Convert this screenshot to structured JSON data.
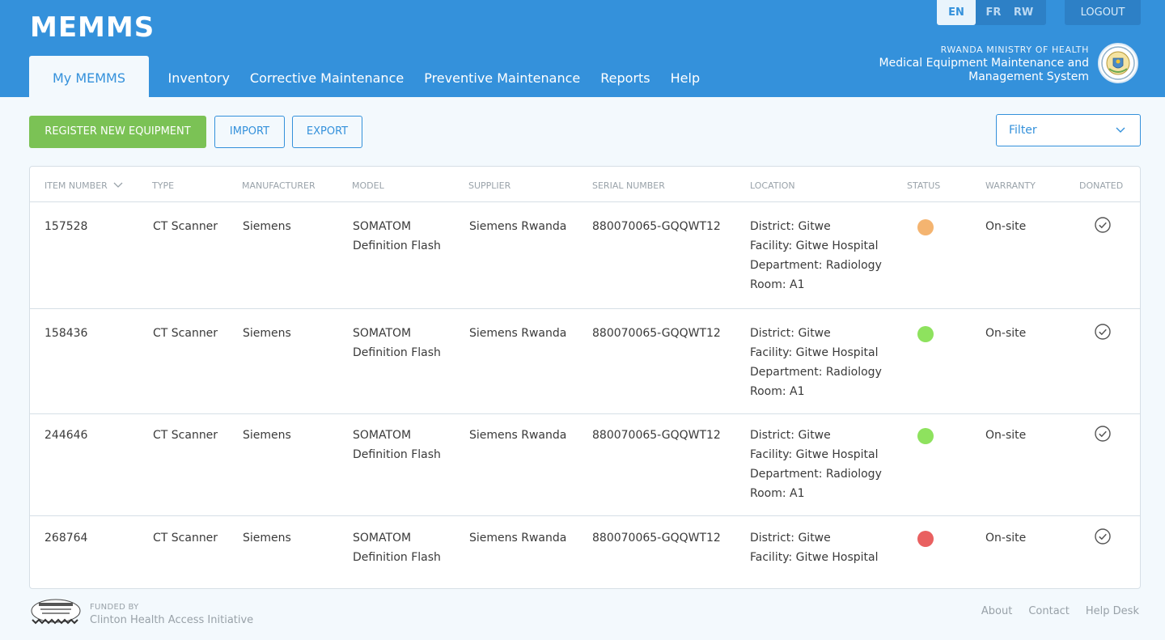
{
  "app": {
    "title": "MEMMS"
  },
  "nav": {
    "items": [
      "My MEMMS",
      "Inventory",
      "Corrective Maintenance",
      "Preventive Maintenance",
      "Reports",
      "Help"
    ]
  },
  "language": {
    "options": [
      "EN",
      "FR",
      "RW"
    ],
    "selected": "EN"
  },
  "logout_label": "LOGOUT",
  "ministry": {
    "line1": "RWANDA MINISTRY OF HEALTH",
    "line2": "Medical Equipment Maintenance and",
    "line3": "Management System"
  },
  "toolbar": {
    "register_label": "REGISTER NEW EQUIPMENT",
    "import_label": "IMPORT",
    "export_label": "EXPORT",
    "filter_placeholder": "Filter"
  },
  "colors": {
    "header": "#3491db",
    "green": "#7bc255",
    "status_pending": "#f4b470",
    "status_ok": "#8ee25e",
    "status_down": "#e96060"
  },
  "table": {
    "columns": [
      "ITEM NUMBER",
      "TYPE",
      "MANUFACTURER",
      "MODEL",
      "SUPPLIER",
      "SERIAL NUMBER",
      "LOCATION",
      "STATUS",
      "WARRANTY",
      "DONATED"
    ],
    "sort_column": "ITEM NUMBER",
    "rows": [
      {
        "item": "157528",
        "type": "CT Scanner",
        "manufacturer": "Siemens",
        "model1": "SOMATOM",
        "model2": "Definition Flash",
        "supplier": "Siemens Rwanda",
        "serial": "880070065-GQQWT12",
        "loc": [
          "District: Gitwe",
          "Facility: Gitwe Hospital",
          "Department: Radiology",
          "Room: A1"
        ],
        "status": "pending",
        "status_color": "#f4b470",
        "warranty": "On-site",
        "donated": true
      },
      {
        "item": "158436",
        "type": "CT Scanner",
        "manufacturer": "Siemens",
        "model1": "SOMATOM",
        "model2": "Definition Flash",
        "supplier": "Siemens Rwanda",
        "serial": "880070065-GQQWT12",
        "loc": [
          "District: Gitwe",
          "Facility: Gitwe Hospital",
          "Department: Radiology",
          "Room: A1"
        ],
        "status": "ok",
        "status_color": "#8ee25e",
        "warranty": "On-site",
        "donated": true
      },
      {
        "item": "244646",
        "type": "CT Scanner",
        "manufacturer": "Siemens",
        "model1": "SOMATOM",
        "model2": "Definition Flash",
        "supplier": "Siemens Rwanda",
        "serial": "880070065-GQQWT12",
        "loc": [
          "District: Gitwe",
          "Facility: Gitwe Hospital",
          "Department: Radiology",
          "Room: A1"
        ],
        "status": "ok",
        "status_color": "#8ee25e",
        "warranty": "On-site",
        "donated": true
      },
      {
        "item": "268764",
        "type": "CT Scanner",
        "manufacturer": "Siemens",
        "model1": "SOMATOM",
        "model2": "Definition Flash",
        "supplier": "Siemens Rwanda",
        "serial": "880070065-GQQWT12",
        "loc": [
          "District: Gitwe",
          "Facility: Gitwe Hospital"
        ],
        "status": "down",
        "status_color": "#e96060",
        "warranty": "On-site",
        "donated": true
      }
    ]
  },
  "footer": {
    "funded_label": "FUNDED BY",
    "funder": "Clinton Health Access Initiative",
    "links": [
      "About",
      "Contact",
      "Help Desk"
    ]
  }
}
